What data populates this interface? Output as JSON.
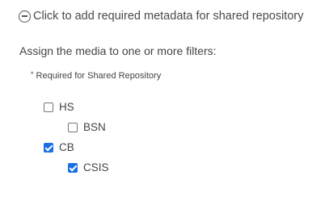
{
  "expander": {
    "label": "Click to add required metadata for shared repository",
    "icon": "minus-circle-icon"
  },
  "assign_label": "Assign the media to one or more filters:",
  "required_note": {
    "star": "*",
    "text": "Required for Shared Repository"
  },
  "filters": [
    {
      "label": "HS",
      "checked": false,
      "level": 0
    },
    {
      "label": "BSN",
      "checked": false,
      "level": 1
    },
    {
      "label": "CB",
      "checked": true,
      "level": 0
    },
    {
      "label": "CSIS",
      "checked": true,
      "level": 1
    }
  ],
  "colors": {
    "checkbox_checked": "#1a6fe6",
    "text": "#444444"
  }
}
